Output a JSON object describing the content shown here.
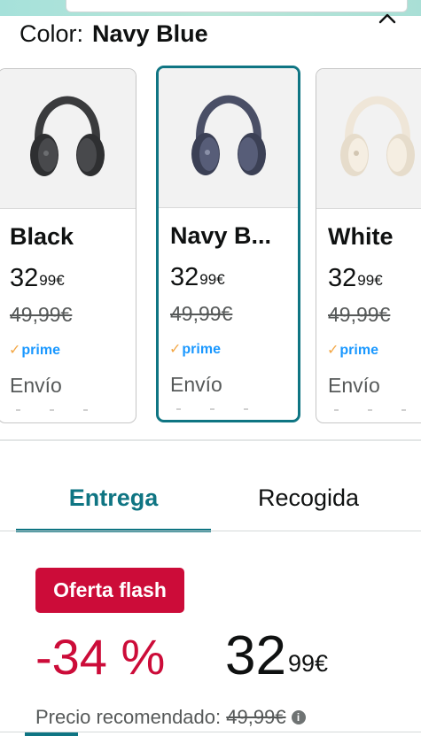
{
  "header": {
    "color_label": "Color:",
    "color_value": "Navy Blue"
  },
  "icons": {
    "close": "chevron-up-icon",
    "info": "info-icon"
  },
  "variants": [
    {
      "name": "Black",
      "price_whole": "32",
      "price_fraction": "99",
      "currency": "€",
      "old_price": "49,99€",
      "prime": "prime",
      "shipping": "Envío",
      "selected": false,
      "headphone_color": "#3a3b3d"
    },
    {
      "name": "Navy B...",
      "price_whole": "32",
      "price_fraction": "99",
      "currency": "€",
      "old_price": "49,99€",
      "prime": "prime",
      "shipping": "Envío",
      "selected": true,
      "headphone_color": "#4a4f66"
    },
    {
      "name": "White",
      "price_whole": "32",
      "price_fraction": "99",
      "currency": "€",
      "old_price": "49,99€",
      "prime": "prime",
      "shipping": "Envío",
      "selected": false,
      "headphone_color": "#efe6d8"
    }
  ],
  "delivery_tabs": [
    {
      "label": "Entrega",
      "active": true
    },
    {
      "label": "Recogida",
      "active": false
    }
  ],
  "deal": {
    "badge": "Oferta flash",
    "discount": "-34 %",
    "price_whole": "32",
    "price_fraction": "99",
    "currency": "€",
    "rrp_label": "Precio recomendado:",
    "rrp_value": "49,99€"
  },
  "colors": {
    "accent": "#0f7583",
    "deal_red": "#cc0c39",
    "prime_blue": "#1a98ff",
    "prime_check": "#f3a847"
  }
}
